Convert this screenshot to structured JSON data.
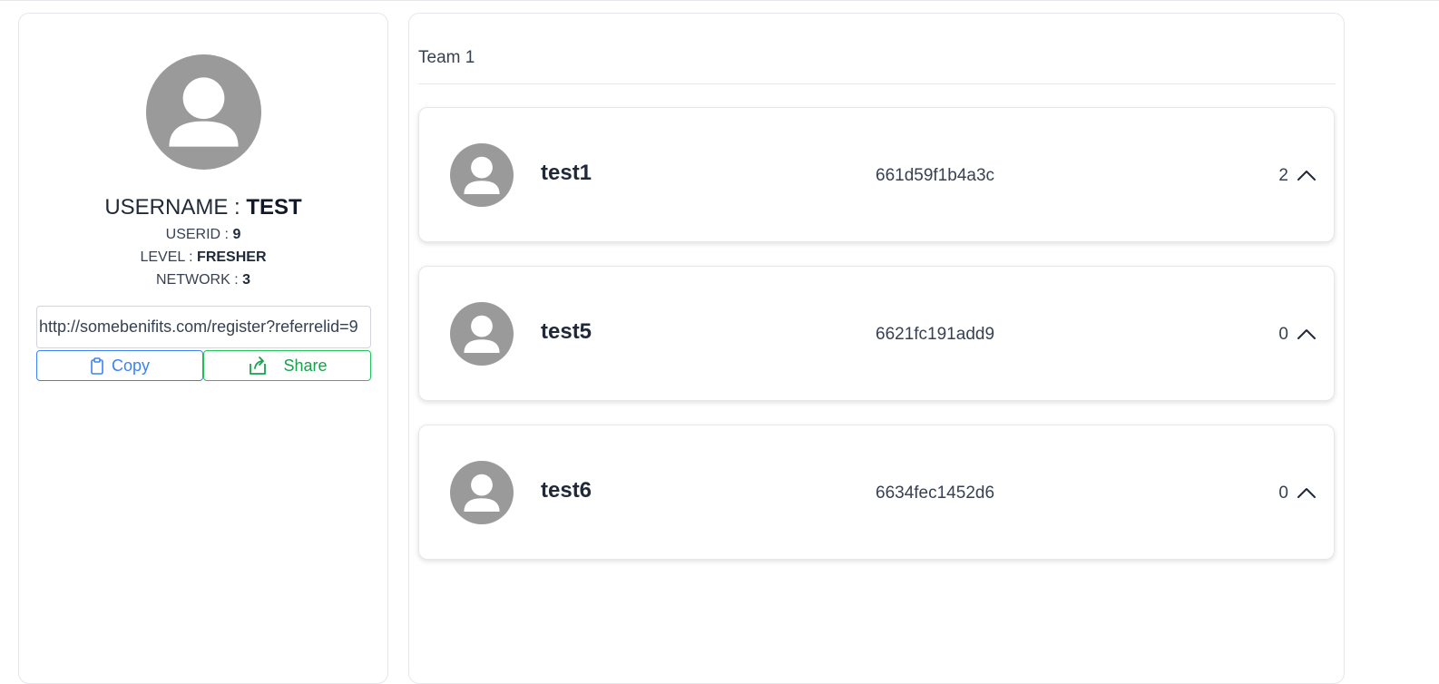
{
  "profile": {
    "username_label": "USERNAME : ",
    "username": "TEST",
    "userid_label": "USERID : ",
    "userid": "9",
    "level_label": "LEVEL : ",
    "level": "FRESHER",
    "network_label": "NETWORK : ",
    "network": "3",
    "referral_link": "http://somebenifits.com/register?referrelid=9",
    "copy_label": "Copy",
    "share_label": "Share",
    "copy_icon": "clipboard-icon",
    "share_icon": "share-icon"
  },
  "team": {
    "title": "Team 1",
    "members": [
      {
        "name": "test1",
        "id": "661d59f1b4a3c",
        "count": "2"
      },
      {
        "name": "test5",
        "id": "6621fc191add9",
        "count": "0"
      },
      {
        "name": "test6",
        "id": "6634fec1452d6",
        "count": "0"
      }
    ]
  },
  "colors": {
    "avatar_bg": "#9a9a9a",
    "copy_accent": "#3b82f6",
    "share_accent": "#22c55e"
  }
}
